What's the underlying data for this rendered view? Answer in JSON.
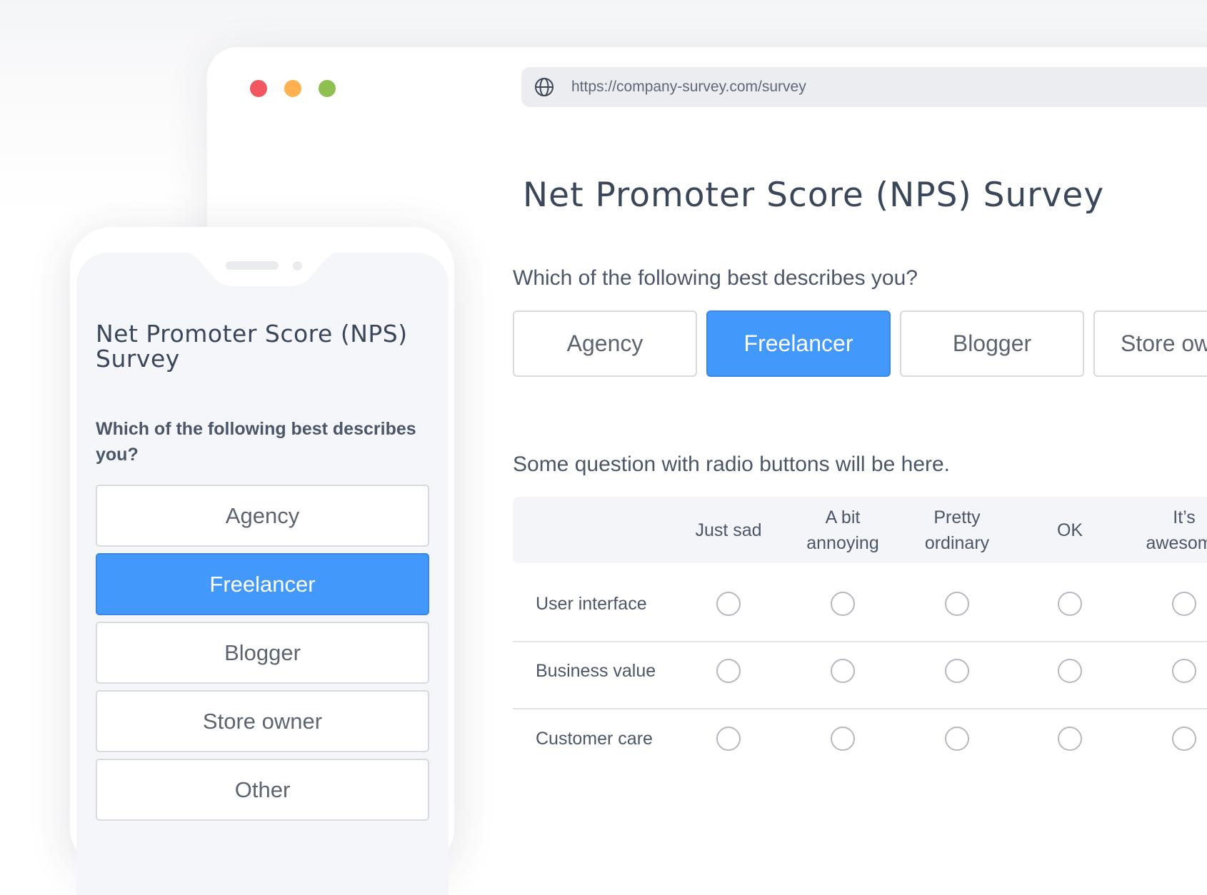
{
  "colors": {
    "accent": "#4399fb",
    "close": "#f25660",
    "minimize": "#ffb14f",
    "maximize": "#8fc04f",
    "text": "#3d4a5c"
  },
  "browser": {
    "url": "https://company-survey.com/survey",
    "url_icon": "globe-icon",
    "title": "Net Promoter Score (NPS) Survey",
    "question1": "Which of the following best describes you?",
    "choices": [
      {
        "label": "Agency",
        "selected": false
      },
      {
        "label": "Freelancer",
        "selected": true
      },
      {
        "label": "Blogger",
        "selected": false
      },
      {
        "label": "Store owner",
        "selected": false
      }
    ],
    "question2": "Some question with radio buttons will be here.",
    "matrix": {
      "columns": [
        "Just sad",
        "A bit annoying",
        "Pretty ordinary",
        "OK",
        "It’s awesome"
      ],
      "rows": [
        "User interface",
        "Business value",
        "Customer care"
      ]
    }
  },
  "phone": {
    "title": "Net Promoter Score (NPS) Survey",
    "question": "Which of the following best describes you?",
    "choices": [
      {
        "label": "Agency",
        "selected": false
      },
      {
        "label": "Freelancer",
        "selected": true
      },
      {
        "label": "Blogger",
        "selected": false
      },
      {
        "label": "Store owner",
        "selected": false
      },
      {
        "label": "Other",
        "selected": false
      }
    ]
  }
}
